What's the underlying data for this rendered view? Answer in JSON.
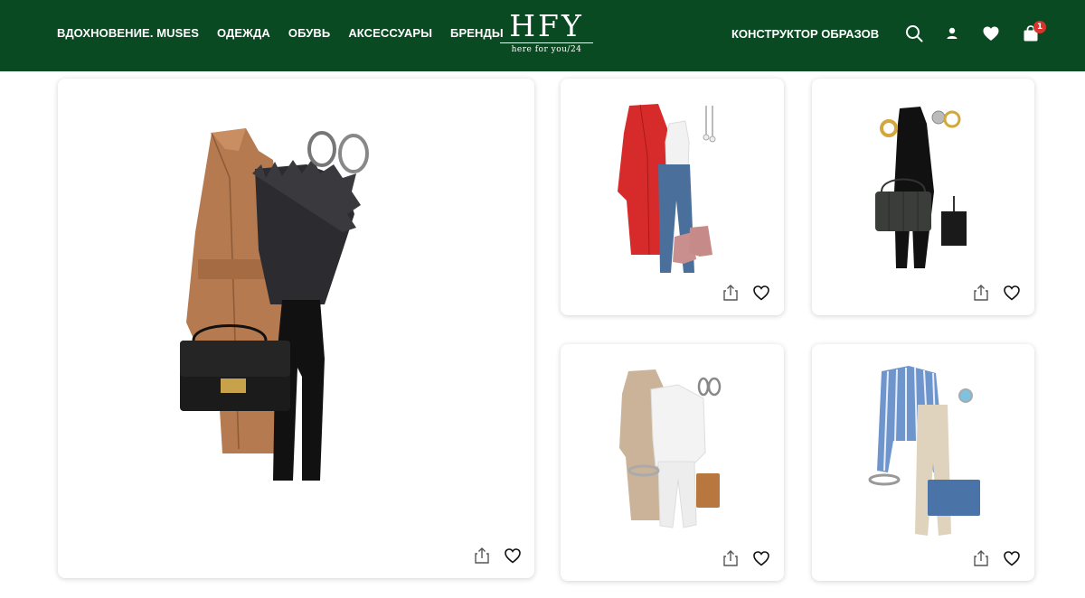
{
  "header": {
    "nav": [
      {
        "label": "ВДОХНОВЕНИЕ. MUSES"
      },
      {
        "label": "ОДЕЖДА"
      },
      {
        "label": "ОБУВЬ"
      },
      {
        "label": "АКСЕССУАРЫ"
      },
      {
        "label": "БРЕНДЫ"
      }
    ],
    "logo": {
      "main": "HFY",
      "tagline": "here for you/24"
    },
    "constructor_label": "КОНСТРУКТОР ОБРАЗОВ",
    "icons": [
      "search-icon",
      "user-icon",
      "heart-icon",
      "bag-icon"
    ],
    "cart_count": "1"
  },
  "colors": {
    "header_bg": "#0a4a22",
    "badge": "#d9342b"
  },
  "looks": [
    {
      "id": "look-1",
      "items": [
        "camel-coat",
        "feather-top",
        "black-trousers",
        "black-handbag",
        "silver-earrings"
      ]
    },
    {
      "id": "look-2",
      "items": [
        "red-coat",
        "white-tank",
        "blue-jeans",
        "pink-boots",
        "drop-earrings"
      ]
    },
    {
      "id": "look-3",
      "items": [
        "black-dress",
        "gold-earrings",
        "flower-earrings",
        "quilted-bag",
        "card-holder"
      ]
    },
    {
      "id": "look-4",
      "items": [
        "teddy-coat",
        "white-sweatshirt",
        "white-joggers",
        "silver-hoops",
        "bracelet",
        "tan-wallet"
      ]
    },
    {
      "id": "look-5",
      "items": [
        "striped-shirt",
        "beige-trousers",
        "blue-clutch",
        "blue-ring",
        "bracelet"
      ]
    }
  ]
}
